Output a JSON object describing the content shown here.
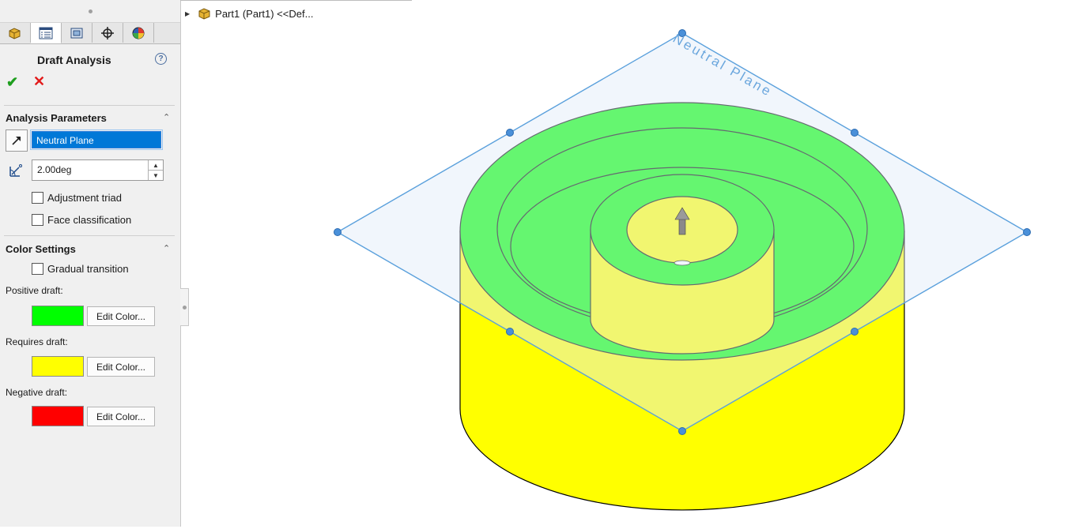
{
  "panel": {
    "title": "Draft Analysis",
    "help_glyph": "?",
    "ok_glyph": "✔",
    "cancel_glyph": "✕",
    "tabs": [
      {
        "name": "feature-manager-tab",
        "icon": "part-icon"
      },
      {
        "name": "property-manager-tab",
        "icon": "property-list-icon",
        "active": true
      },
      {
        "name": "configuration-manager-tab",
        "icon": "configuration-icon"
      },
      {
        "name": "dimxpert-tab",
        "icon": "crosshair-icon"
      },
      {
        "name": "display-manager-tab",
        "icon": "appearance-pie-icon"
      }
    ],
    "analysis": {
      "header": "Analysis Parameters",
      "direction_value": "Neutral Plane",
      "angle_value": "2.00deg",
      "adjustment_triad": "Adjustment triad",
      "face_classification": "Face classification"
    },
    "color": {
      "header": "Color Settings",
      "gradual_transition": "Gradual transition",
      "positive_label": "Positive draft:",
      "requires_label": "Requires draft:",
      "negative_label": "Negative draft:",
      "edit_color": "Edit Color...",
      "positive_color": "#00ff00",
      "requires_color": "#ffff00",
      "negative_color": "#ff0000"
    }
  },
  "tree": {
    "item": "Part1 (Part1) <<Def..."
  },
  "viewport": {
    "plane_label": "Neutral Plane",
    "plane_color": "#5aa0dc",
    "positive_color": "#00ff00",
    "requires_color": "#ffff00"
  }
}
